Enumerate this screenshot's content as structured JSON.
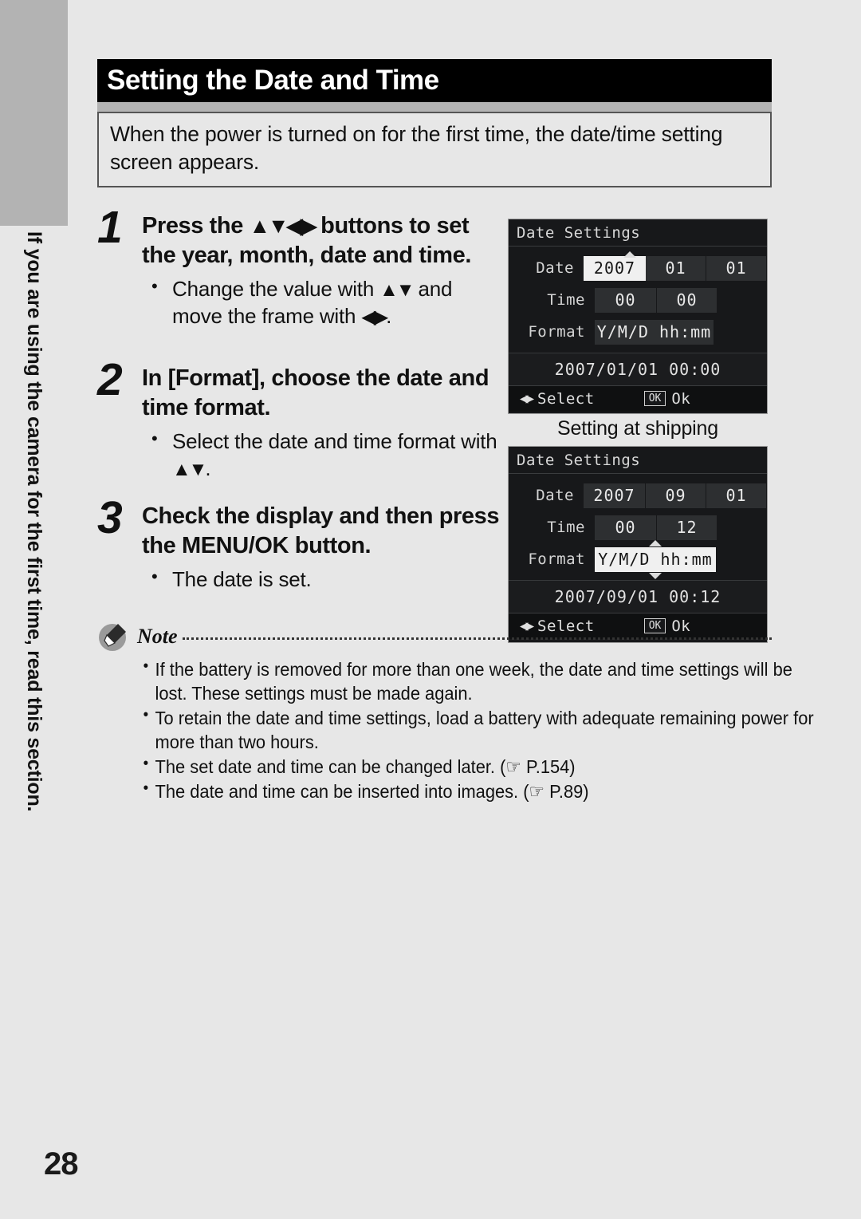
{
  "page": {
    "number": "28",
    "side_tab_text": "If you are using the camera for the first time, read this section."
  },
  "header": {
    "title": "Setting the Date and Time",
    "intro": "When the power is turned on for the first time, the date/time setting screen appears."
  },
  "steps": [
    {
      "number": "1",
      "heading_pre": "Press the ",
      "heading_arrows": "▲▼◀▶",
      "heading_post": " buttons to set the year, month, date and time.",
      "bullets": [
        {
          "pre": "Change the value with ",
          "arrows1": "▲▼",
          "mid": " and move the frame with ",
          "arrows2": "◀▶",
          "post": "."
        }
      ]
    },
    {
      "number": "2",
      "heading_pre": "In [Format], choose the date and time format.",
      "heading_arrows": "",
      "heading_post": "",
      "bullets": [
        {
          "pre": "Select the date and time format with ",
          "arrows1": "▲▼",
          "mid": "",
          "arrows2": "",
          "post": "."
        }
      ]
    },
    {
      "number": "3",
      "heading_pre": "Check the display and then press the MENU/OK button.",
      "heading_arrows": "",
      "heading_post": "",
      "bullets": [
        {
          "pre": "The date is set.",
          "arrows1": "",
          "mid": "",
          "arrows2": "",
          "post": ""
        }
      ]
    }
  ],
  "lcd_screens": [
    {
      "title": "Date Settings",
      "rows": {
        "date_label": "Date",
        "date_year": "2007",
        "date_month": "01",
        "date_day": "01",
        "time_label": "Time",
        "time_hour": "00",
        "time_min": "00",
        "format_label": "Format",
        "format_value": "Y/M/D hh:mm"
      },
      "selected_field": "date_year",
      "summary": "2007/01/01 00:00",
      "foot_select_arrows": "◀▶",
      "foot_select_label": "Select",
      "foot_ok_key": "OK",
      "foot_ok_label": "Ok"
    },
    {
      "title": "Date Settings",
      "rows": {
        "date_label": "Date",
        "date_year": "2007",
        "date_month": "09",
        "date_day": "01",
        "time_label": "Time",
        "time_hour": "00",
        "time_min": "12",
        "format_label": "Format",
        "format_value": "Y/M/D hh:mm"
      },
      "selected_field": "format_value",
      "summary": "2007/09/01 00:12",
      "foot_select_arrows": "◀▶",
      "foot_select_label": "Select",
      "foot_ok_key": "OK",
      "foot_ok_label": "Ok"
    }
  ],
  "shipping_caption": "Setting at shipping",
  "note": {
    "label": "Note",
    "items": [
      "If the battery is removed for more than one week, the date and time settings will be lost. These settings must be made again.",
      "To retain the date and time settings, load a battery with adequate remaining power for more than two hours.",
      "The set date and time can be changed later. (☞ P.154)",
      "The date and time can be inserted into images. (☞ P.89)"
    ]
  }
}
